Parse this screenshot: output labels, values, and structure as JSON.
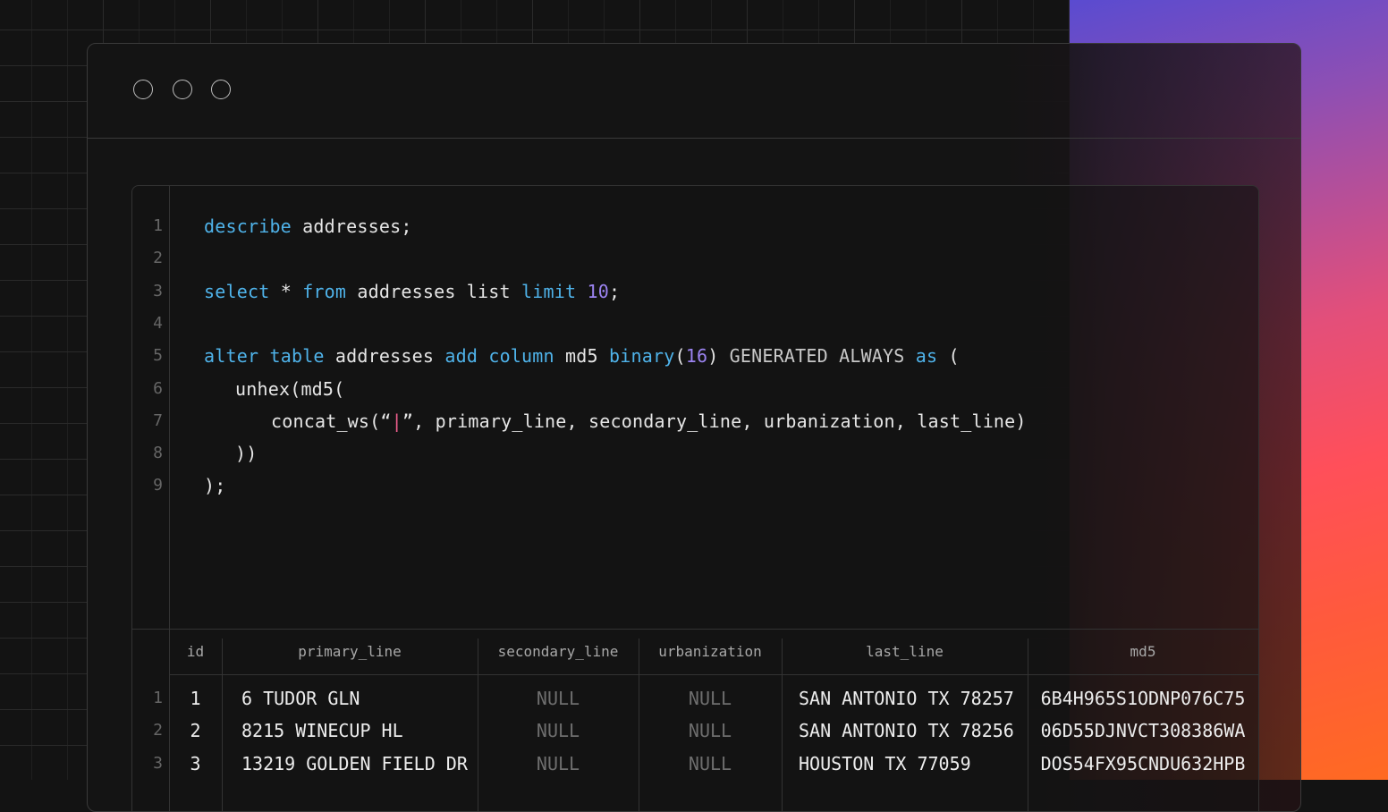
{
  "window_controls": [
    "window-dot-1",
    "window-dot-2",
    "window-dot-3"
  ],
  "editor": {
    "line_numbers": [
      "1",
      "2",
      "3",
      "4",
      "5",
      "6",
      "7",
      "8",
      "9"
    ],
    "lines": [
      {
        "line": 1,
        "tokens": [
          [
            "kw",
            "describe"
          ],
          [
            "",
            " addresses;"
          ]
        ]
      },
      {
        "line": 3,
        "tokens": [
          [
            "kw",
            "select"
          ],
          [
            "",
            " * "
          ],
          [
            "kw",
            "from"
          ],
          [
            "",
            " addresses list "
          ],
          [
            "kw",
            "limit"
          ],
          [
            "",
            " "
          ],
          [
            "num",
            "10"
          ],
          [
            "",
            ";"
          ]
        ]
      },
      {
        "line": 5,
        "tokens": [
          [
            "kw",
            "alter"
          ],
          [
            "",
            " "
          ],
          [
            "kw",
            "table"
          ],
          [
            "",
            " addresses "
          ],
          [
            "kw",
            "add"
          ],
          [
            "",
            " "
          ],
          [
            "kw",
            "column"
          ],
          [
            "",
            " md5 "
          ],
          [
            "kw",
            "binary"
          ],
          [
            "",
            "("
          ],
          [
            "num",
            "16"
          ],
          [
            "",
            ") "
          ],
          [
            "dim",
            "GENERATED ALWAYS"
          ],
          [
            "",
            " "
          ],
          [
            "kw",
            "as"
          ],
          [
            "",
            " ("
          ]
        ]
      },
      {
        "line": 6,
        "indent": 1,
        "tokens": [
          [
            "",
            "unhex(md5("
          ]
        ]
      },
      {
        "line": 7,
        "indent": 2,
        "tokens": [
          [
            "",
            "concat_ws("
          ],
          [
            "",
            "“"
          ],
          [
            "str",
            "|"
          ],
          [
            "",
            "”, primary_line, secondary_line, urbanization, last_line)"
          ]
        ]
      },
      {
        "line": 8,
        "indent": 1,
        "tokens": [
          [
            "",
            "))"
          ]
        ]
      },
      {
        "line": 9,
        "tokens": [
          [
            "",
            ");"
          ]
        ]
      }
    ]
  },
  "results": {
    "columns": [
      "id",
      "primary_line",
      "secondary_line",
      "urbanization",
      "last_line",
      "md5"
    ],
    "row_numbers": [
      "1",
      "2",
      "3"
    ],
    "rows": [
      [
        "1",
        "6 TUDOR GLN",
        "NULL",
        "NULL",
        "SAN ANTONIO TX 78257",
        "6B4H965S1ODNP076C75"
      ],
      [
        "2",
        "8215 WINECUP HL",
        "NULL",
        "NULL",
        "SAN ANTONIO TX 78256",
        "06D55DJNVCT308386WA"
      ],
      [
        "3",
        "13219 GOLDEN FIELD DR",
        "NULL",
        "NULL",
        "HOUSTON TX 77059",
        "DOS54FX95CNDU632HPB"
      ]
    ]
  },
  "colors": {
    "keyword": "#4fb3ea",
    "number": "#9b83f0",
    "string": "#e95d8a",
    "background": "#131313"
  }
}
